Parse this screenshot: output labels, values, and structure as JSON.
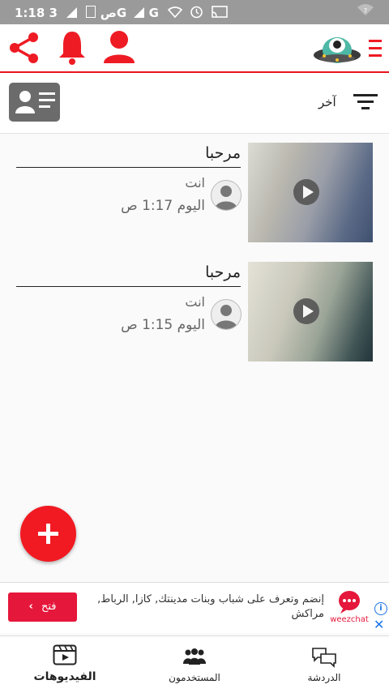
{
  "status_bar": {
    "time": "1:18 ص",
    "network_3g": "3G",
    "network_g": "G",
    "icons": [
      "wifi-icon",
      "alarm-icon",
      "cast-icon",
      "wifi-question-icon"
    ]
  },
  "header": {
    "icons": [
      "share-icon",
      "bell-icon",
      "user-icon",
      "app-logo-icon",
      "menu-icon"
    ],
    "accent": "#e8141e"
  },
  "filter": {
    "label": "آخر"
  },
  "videos": [
    {
      "title": "مرحبا",
      "author": "انت",
      "time": "اليوم 1:17 ص"
    },
    {
      "title": "مرحبا",
      "author": "انت",
      "time": "اليوم 1:15 ص"
    }
  ],
  "ad": {
    "text": "إنضم وتعرف على شباب وبنات مدينتك, كازا, الرباط, مراكش",
    "button": "فتح",
    "brand": "weezchat",
    "brand_color": "#e5173b"
  },
  "bottom_nav": [
    {
      "label": "الفيديوهات",
      "icon": "video-icon",
      "active": true
    },
    {
      "label": "المستخدمون",
      "icon": "users-icon",
      "active": false
    },
    {
      "label": "الدردشة",
      "icon": "chat-icon",
      "active": false
    }
  ]
}
